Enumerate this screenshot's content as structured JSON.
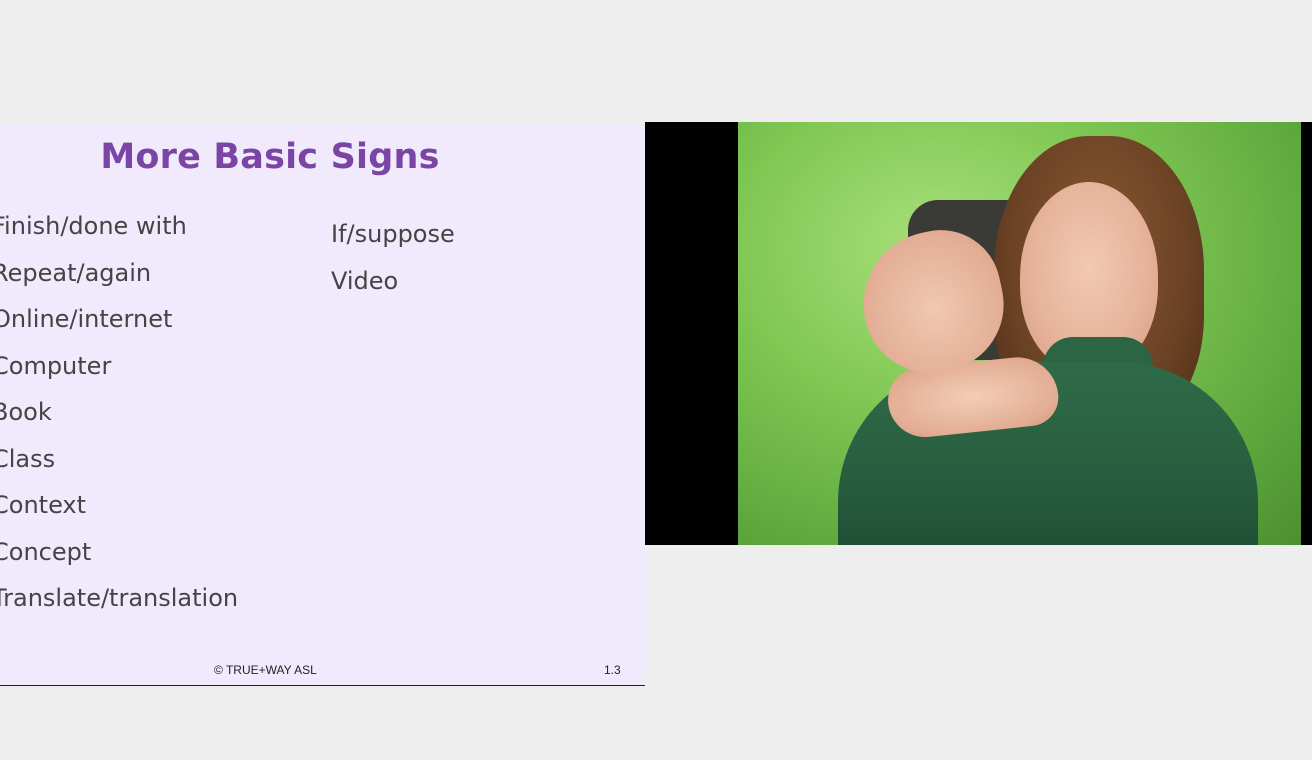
{
  "slide": {
    "title": "More Basic Signs",
    "left_column": [
      "Finish/done with",
      "Repeat/again",
      "Online/internet",
      "Computer",
      "Book",
      "Class",
      "Context",
      "Concept",
      "Translate/translation"
    ],
    "right_column": [
      "If/suppose",
      "Video"
    ],
    "footer_copyright": "© TRUE+WAY ASL",
    "slide_number": "1.3",
    "colors": {
      "title": "#7a45a4",
      "background": "#f0eafc",
      "text": "#444444"
    }
  },
  "video": {
    "content": "presenter-signing"
  }
}
